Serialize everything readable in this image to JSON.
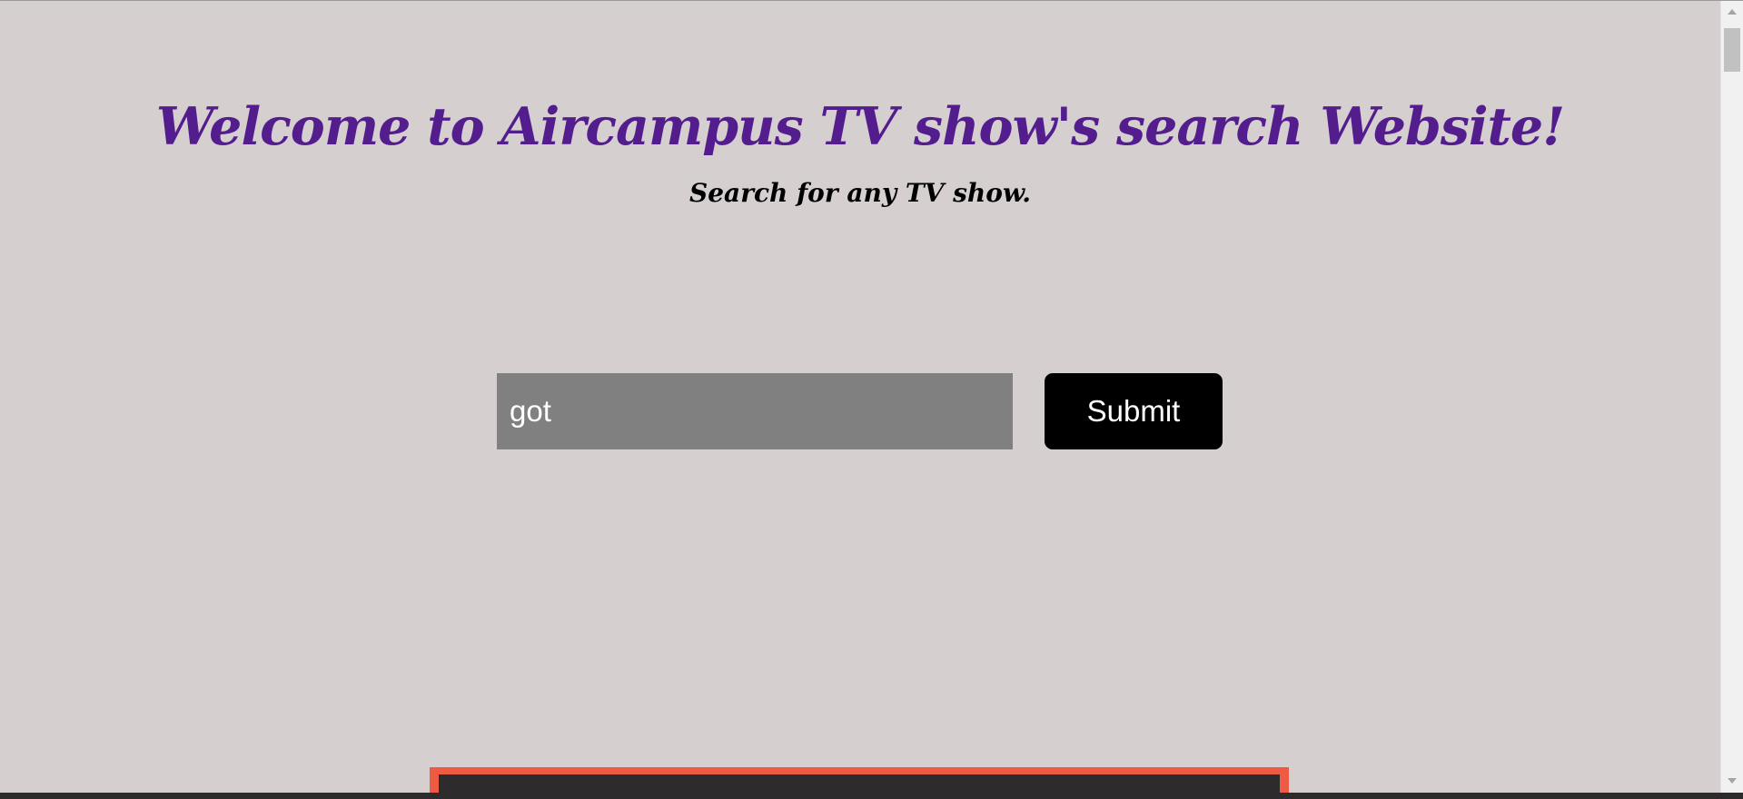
{
  "header": {
    "title": "Welcome to Aircampus TV show's search Website!",
    "subtitle": "Search for any TV show."
  },
  "search": {
    "value": "got",
    "submit_label": "Submit"
  },
  "colors": {
    "background": "#d5cfd0",
    "title": "#541d8e",
    "input_background": "#808080",
    "button_background": "#000000",
    "card_border": "#ef5a44",
    "card_background": "#2d2b2b"
  },
  "icons": {
    "scroll_up": "chevron-up-icon",
    "scroll_down": "chevron-down-icon"
  }
}
